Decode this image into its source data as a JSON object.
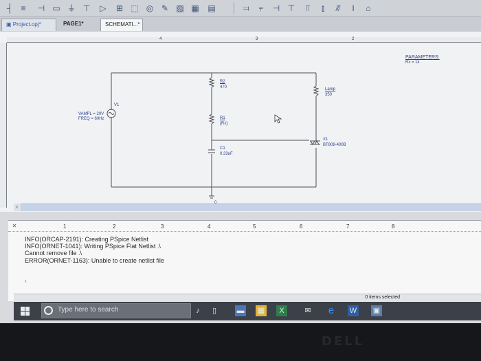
{
  "toolbar": {
    "icons": [
      "wire-icon",
      "bus-icon",
      "net-alias-icon",
      "part-icon",
      "ground-icon",
      "power-icon",
      "offpage-icon",
      "text-icon",
      "align-left-icon",
      "align-center-icon",
      "align-right-icon",
      "distribute-icon",
      "chart-icon",
      "graph-icon",
      "marker-icon"
    ]
  },
  "tabs": {
    "project": "Project.opj*",
    "page": "PAGE1*",
    "schematic": "SCHEMATI...*"
  },
  "rulers": {
    "top": [
      "4",
      "3",
      "2"
    ],
    "bottom": [
      "1",
      "2",
      "3",
      "4",
      "5",
      "6",
      "7",
      "8"
    ]
  },
  "schematic": {
    "parameters": {
      "title": "PARAMETERS:",
      "value": "Rx = 1k"
    },
    "source": {
      "ref": "V1",
      "vampl": "VAMPL = 20V",
      "freq": "FREQ = 60Hz"
    },
    "r2": {
      "ref": "R2",
      "value": "470"
    },
    "r1": {
      "ref": "R1",
      "value": "{Rx}"
    },
    "c1": {
      "ref": "C1",
      "value": "0.33uF"
    },
    "lamp": {
      "ref": "Lamp",
      "value": "350"
    },
    "triac": {
      "ref": "X1",
      "value": "BT808-400B"
    },
    "ground": {
      "label": "0"
    }
  },
  "log": {
    "lines": [
      "INFO(ORCAP-2191): Creating PSpice Netlist",
      "INFO(ORNET-1041): Writing PSpice Flat Netlist .\\",
      "Cannot remove file .\\",
      "ERROR(ORNET-1163): Unable to create netlist file"
    ]
  },
  "status": {
    "selected": "0 items selected"
  },
  "taskbar": {
    "search_placeholder": "Type here to search"
  },
  "bezel": {
    "brand": "DELL"
  }
}
